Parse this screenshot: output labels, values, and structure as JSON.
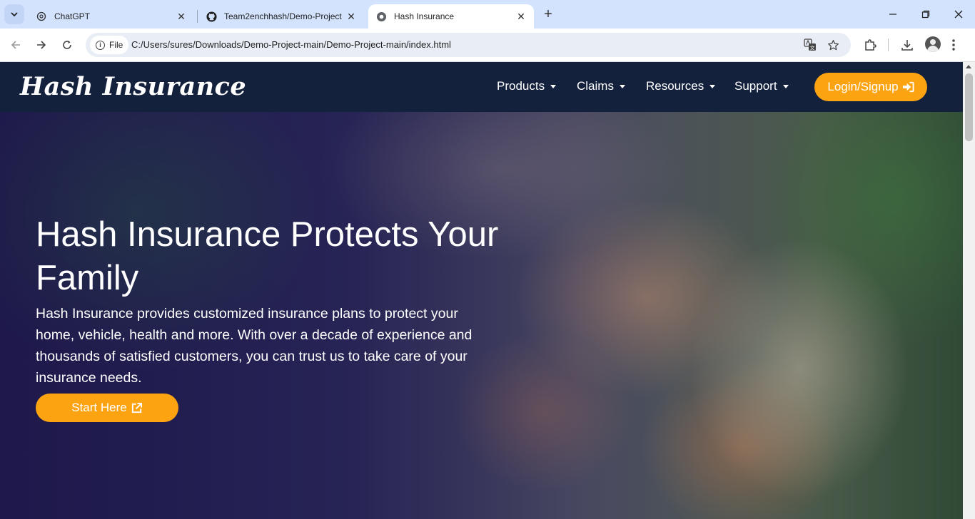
{
  "browser": {
    "tabs": [
      {
        "title": "ChatGPT",
        "icon": "chatgpt-icon",
        "active": false
      },
      {
        "title": "Team2enchhash/Demo-Project",
        "icon": "github-icon",
        "active": false
      },
      {
        "title": "Hash Insurance",
        "icon": "globe-icon",
        "active": true
      }
    ],
    "address_bar": {
      "scheme_label": "File",
      "url": "C:/Users/sures/Downloads/Demo-Project-main/Demo-Project-main/index.html"
    }
  },
  "site": {
    "brand": "Hash Insurance",
    "nav": [
      {
        "label": "Products"
      },
      {
        "label": "Claims"
      },
      {
        "label": "Resources"
      },
      {
        "label": "Support"
      }
    ],
    "login_label": "Login/Signup",
    "hero": {
      "title": "Hash Insurance Protects Your Family",
      "text": "Hash Insurance provides customized insurance plans to protect your home, vehicle, health and more. With over a decade of experience and thousands of satisfied customers, you can trust us to take care of your insurance needs.",
      "cta_label": "Start Here"
    }
  },
  "colors": {
    "navbar": "#14213d",
    "accent": "#fca311",
    "tabstrip": "#d3e3fd"
  }
}
